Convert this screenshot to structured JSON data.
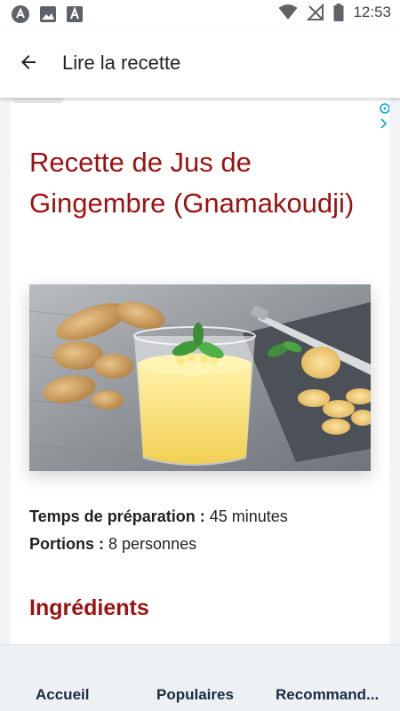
{
  "status_bar": {
    "time": "12:53",
    "icons": [
      "assistant-icon",
      "image-icon",
      "font-download-icon",
      "wifi-icon",
      "no-signal-icon",
      "battery-icon"
    ]
  },
  "header": {
    "back_icon": "arrow-back-icon",
    "title": "Lire la recette"
  },
  "recipe": {
    "title": "Recette de Jus de Gingembre (Gnamakoudji)",
    "image_subject": "ginger-juice-photo",
    "prep_label": "Temps de préparation :",
    "prep_value": "45 minutes",
    "portions_label": "Portions :",
    "portions_value": "8 personnes",
    "ingredients_heading": "Ingrédients"
  },
  "bottom_nav": {
    "items": [
      {
        "label": "Accueil"
      },
      {
        "label": "Populaires"
      },
      {
        "label": "Recommand..."
      }
    ]
  },
  "colors": {
    "accent": "#9b1212",
    "nav_text": "#1d2a44",
    "page_bg": "#f1f3f6",
    "ad_marker": "#00aecd"
  }
}
